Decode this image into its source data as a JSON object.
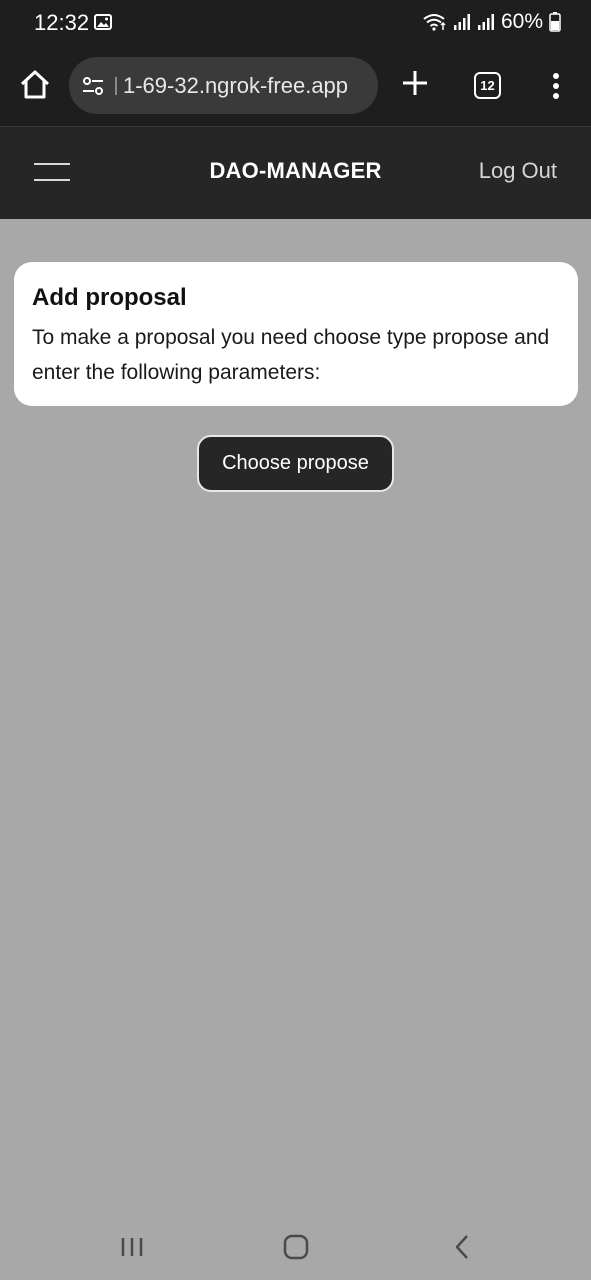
{
  "status_bar": {
    "time": "12:32",
    "battery": "60%",
    "icons": [
      "gallery-icon",
      "wifi-icon",
      "signal-icon",
      "signal-icon",
      "battery-icon"
    ]
  },
  "browser": {
    "url": "1-69-32.ngrok-free.app",
    "tab_count": "12",
    "icons": [
      "home-icon",
      "tune-icon",
      "plus-icon",
      "tabs-icon",
      "more-vert-icon"
    ]
  },
  "header": {
    "title": "DAO-MANAGER",
    "logout_label": "Log Out",
    "menu_icon": "hamburger-icon"
  },
  "proposal_card": {
    "title": "Add proposal",
    "description": "To make a proposal you need choose type propose and enter the following parameters:"
  },
  "actions": {
    "choose_label": "Choose propose"
  },
  "system_nav": {
    "icons": [
      "recents-icon",
      "home-circle-icon",
      "back-icon"
    ]
  },
  "colors": {
    "page_bg": "#a8a8a8",
    "header_bg": "#262626",
    "card_bg": "#ffffff",
    "button_bg": "#262626"
  }
}
